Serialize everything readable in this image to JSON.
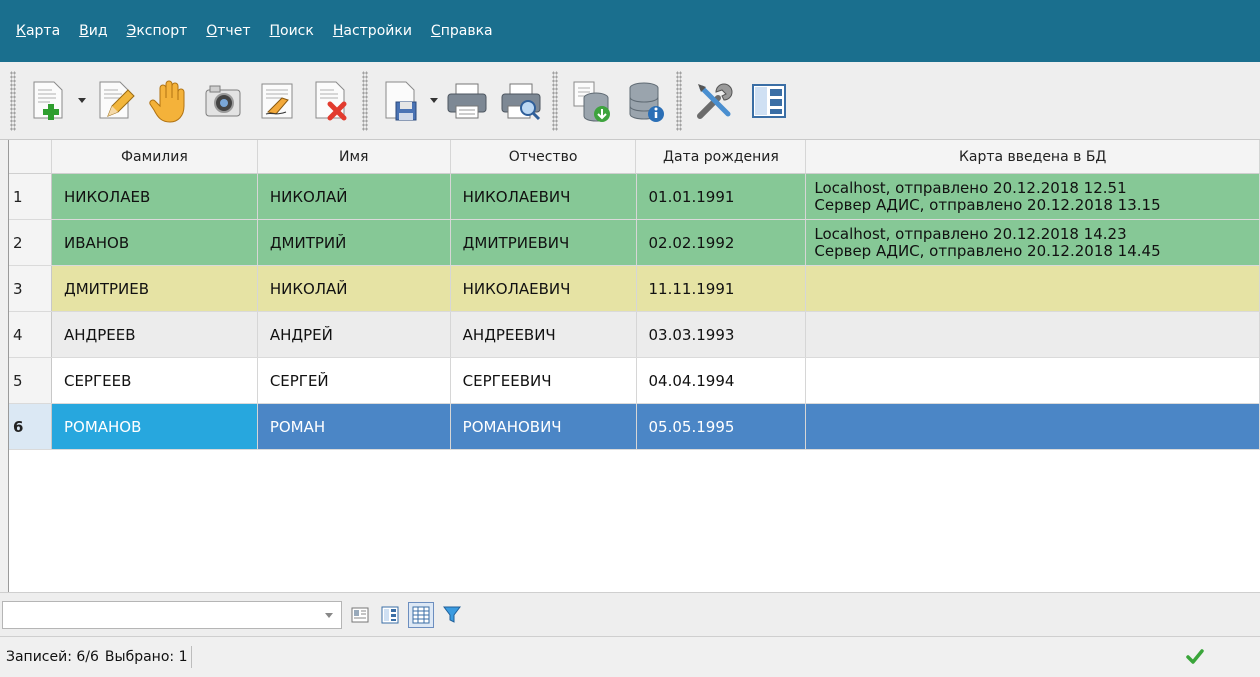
{
  "menu": [
    {
      "acc": "К",
      "rest": "арта"
    },
    {
      "acc": "В",
      "rest": "ид"
    },
    {
      "acc": "Э",
      "rest": "кспорт"
    },
    {
      "acc": "О",
      "rest": "тчет"
    },
    {
      "acc": "П",
      "rest": "оиск"
    },
    {
      "acc": "Н",
      "rest": "астройки"
    },
    {
      "acc": "С",
      "rest": "правка"
    }
  ],
  "toolbar": {
    "icons": [
      "new-card-icon",
      "edit-card-icon",
      "hand-icon",
      "camera-icon",
      "sign-icon",
      "delete-card-icon",
      "save-icon",
      "print-icon",
      "print-preview-icon",
      "db-export-icon",
      "db-info-icon",
      "tools-icon",
      "layout-icon"
    ]
  },
  "grid": {
    "columns": [
      "",
      "Фамилия",
      "Имя",
      "Отчество",
      "Дата рождения",
      "Карта введена в БД"
    ],
    "rows": [
      {
        "n": "1",
        "last": "НИКОЛАЕВ",
        "first": "НИКОЛАЙ",
        "middle": "НИКОЛАЕВИЧ",
        "dob": "01.01.1991",
        "db1": "Localhost, отправлено 20.12.2018 12.51",
        "db2": "Сервер АДИС, отправлено 20.12.2018 13.15"
      },
      {
        "n": "2",
        "last": "ИВАНОВ",
        "first": "ДМИТРИЙ",
        "middle": "ДМИТРИЕВИЧ",
        "dob": "02.02.1992",
        "db1": "Localhost, отправлено 20.12.2018 14.23",
        "db2": "Сервер АДИС, отправлено 20.12.2018 14.45"
      },
      {
        "n": "3",
        "last": "ДМИТРИЕВ",
        "first": "НИКОЛАЙ",
        "middle": "НИКОЛАЕВИЧ",
        "dob": "11.11.1991",
        "db1": "",
        "db2": ""
      },
      {
        "n": "4",
        "last": "АНДРЕЕВ",
        "first": "АНДРЕЙ",
        "middle": "АНДРЕЕВИЧ",
        "dob": "03.03.1993",
        "db1": "",
        "db2": ""
      },
      {
        "n": "5",
        "last": "СЕРГЕЕВ",
        "first": "СЕРГЕЙ",
        "middle": "СЕРГЕЕВИЧ",
        "dob": "04.04.1994",
        "db1": "",
        "db2": ""
      },
      {
        "n": "6",
        "last": "РОМАНОВ",
        "first": "РОМАН",
        "middle": "РОМАНОВИЧ",
        "dob": "05.05.1995",
        "db1": "",
        "db2": ""
      }
    ],
    "row_states": [
      "green",
      "green",
      "yellow",
      "gray",
      "white",
      "sel"
    ],
    "colors": {
      "sent": "#86c896",
      "partial": "#e6e3a4",
      "selected": "#4b86c6",
      "selected_cell": "#27a7de"
    }
  },
  "filter": {
    "value": ""
  },
  "status": {
    "records": "Записей: 6/6",
    "selected": "Выбрано: 1"
  }
}
